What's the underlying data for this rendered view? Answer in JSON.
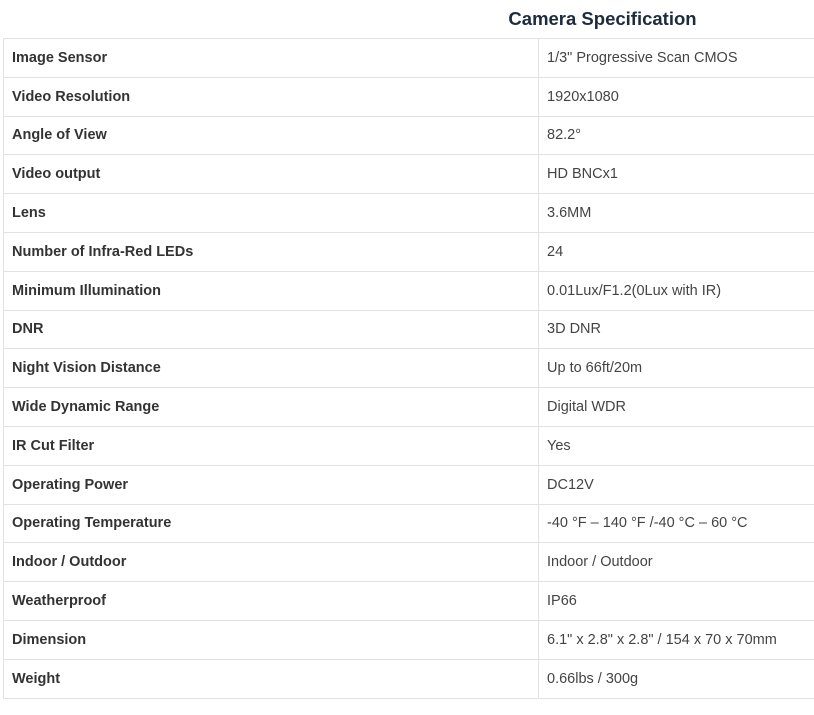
{
  "title": "Camera Specification",
  "rows": [
    {
      "label": "Image Sensor",
      "value": "1/3\" Progressive Scan CMOS"
    },
    {
      "label": "Video Resolution",
      "value": "1920x1080"
    },
    {
      "label": "Angle of View",
      "value": "82.2°"
    },
    {
      "label": "Video output",
      "value": "HD BNCx1"
    },
    {
      "label": "Lens",
      "value": "3.6MM"
    },
    {
      "label": "Number of Infra-Red LEDs",
      "value": "24"
    },
    {
      "label": "Minimum Illumination",
      "value": "0.01Lux/F1.2(0Lux with IR)"
    },
    {
      "label": "DNR",
      "value": "3D DNR"
    },
    {
      "label": "Night Vision Distance",
      "value": "Up to 66ft/20m"
    },
    {
      "label": "Wide Dynamic Range",
      "value": "Digital WDR"
    },
    {
      "label": "IR Cut Filter",
      "value": "Yes"
    },
    {
      "label": "Operating Power",
      "value": "DC12V"
    },
    {
      "label": "Operating Temperature",
      "value": "-40 °F – 140 °F /-40 °C – 60 °C"
    },
    {
      "label": "Indoor / Outdoor",
      "value": "Indoor / Outdoor"
    },
    {
      "label": "Weatherproof",
      "value": "IP66"
    },
    {
      "label": "Dimension",
      "value": "6.1\" x 2.8\" x 2.8\" / 154 x 70 x 70mm"
    },
    {
      "label": "Weight",
      "value": "0.66lbs / 300g"
    }
  ]
}
